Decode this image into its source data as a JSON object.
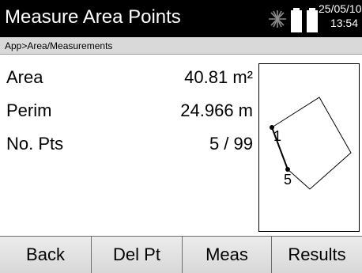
{
  "header": {
    "title": "Measure Area Points",
    "date": "25/05/10",
    "time": "13:54",
    "icons": [
      "laser-icon",
      "battery-icon"
    ]
  },
  "breadcrumb": "App>Area/Measurements",
  "results": [
    {
      "label": "Area",
      "value": "40.81  m²"
    },
    {
      "label": "Perim",
      "value": "24.966 m"
    },
    {
      "label": "No. Pts",
      "value": "5 / 99"
    }
  ],
  "sketch": {
    "point_labels": [
      "1",
      "5"
    ]
  },
  "softkeys": [
    "Back",
    "Del Pt",
    "Meas",
    "Results"
  ]
}
